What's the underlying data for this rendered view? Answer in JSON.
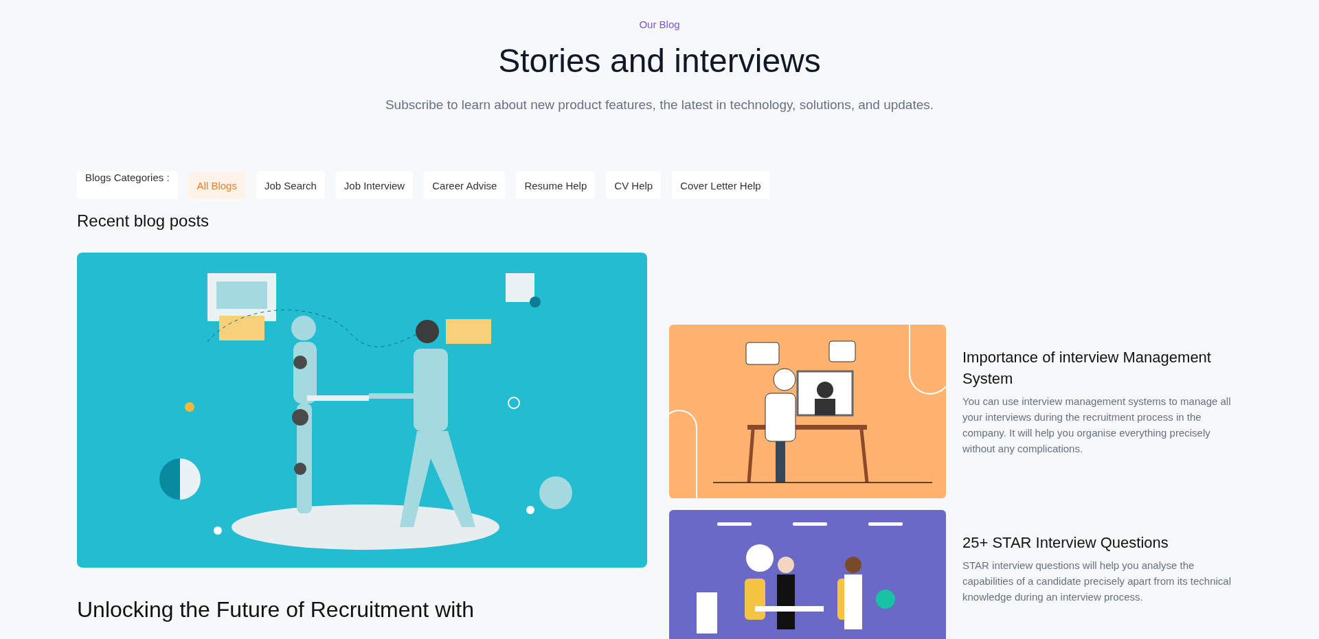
{
  "header": {
    "eyebrow": "Our Blog",
    "title": "Stories and interviews",
    "subtitle": "Subscribe to learn about new product features, the latest in technology, solutions, and updates."
  },
  "categories": {
    "label": "Blogs Categories :",
    "items": [
      {
        "label": "All Blogs",
        "selected": true
      },
      {
        "label": "Job Search",
        "selected": false
      },
      {
        "label": "Job Interview",
        "selected": false
      },
      {
        "label": "Career Advise",
        "selected": false
      },
      {
        "label": "Resume Help",
        "selected": false
      },
      {
        "label": "CV Help",
        "selected": false
      },
      {
        "label": "Cover Letter Help",
        "selected": false
      }
    ]
  },
  "section_title": "Recent blog posts",
  "featured": {
    "title": "Unlocking the Future of Recruitment with"
  },
  "side_posts": [
    {
      "kind": "video-call",
      "title": "Importance of interview Management System",
      "description": "You can use interview management systems to manage all your interviews during the recruitment process in the company. It will help you organise everything precisely without any complications."
    },
    {
      "kind": "meeting",
      "title": "25+ STAR Interview Questions",
      "description": "STAR interview questions will help you analyse the capabilities of a candidate precisely apart from its technical knowledge during an interview process."
    }
  ]
}
